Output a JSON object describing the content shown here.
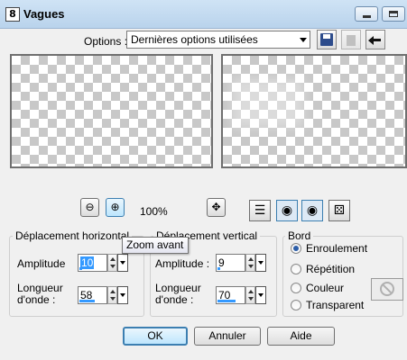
{
  "window": {
    "icon_text": "8",
    "title": "Vagues"
  },
  "options": {
    "label": "Options :",
    "selected": "Dernières options utilisées"
  },
  "zoom": {
    "level": "100%",
    "tooltip": "Zoom avant"
  },
  "horizontal": {
    "title": "Déplacement horizontal",
    "amplitude_label": "Amplitude",
    "amplitude_value": "10",
    "amplitude_level": 0.1,
    "wavelength_label_1": "Longueur",
    "wavelength_label_2": "d'onde :",
    "wavelength_value": "58",
    "wavelength_level": 0.58
  },
  "vertical": {
    "title": "Déplacement vertical",
    "amplitude_label": "Amplitude :",
    "amplitude_value": "9",
    "amplitude_level": 0.09,
    "wavelength_label_1": "Longueur",
    "wavelength_label_2": "d'onde :",
    "wavelength_value": "70",
    "wavelength_level": 0.7
  },
  "edge": {
    "title": "Bord",
    "options": [
      "Enroulement",
      "Répétition",
      "Couleur",
      "Transparent"
    ],
    "selected": "Enroulement"
  },
  "buttons": {
    "ok": "OK",
    "cancel": "Annuler",
    "help": "Aide"
  },
  "icons": [
    "app-icon",
    "minimize-icon",
    "maximize-icon",
    "save-icon",
    "delete-icon",
    "reset-icon",
    "zoom-out-icon",
    "zoom-in-icon",
    "pan-icon",
    "proof-icon",
    "auto-proof-icon",
    "eye-icon",
    "randomize-icon",
    "no-color-icon"
  ]
}
